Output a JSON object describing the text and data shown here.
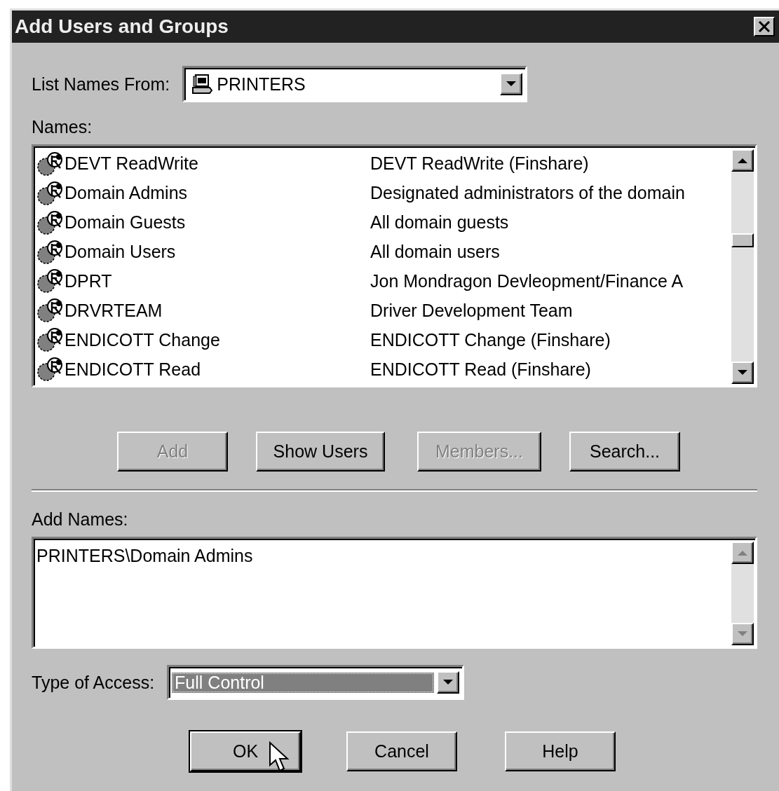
{
  "window": {
    "title": "Add Users and Groups"
  },
  "list_names_from": {
    "label": "List Names From:",
    "value": "PRINTERS"
  },
  "names": {
    "label": "Names:",
    "rows": [
      {
        "name": "DEVT ReadWrite",
        "description": "DEVT ReadWrite (Finshare)",
        "selected": false
      },
      {
        "name": "Domain Admins",
        "description": "Designated administrators of the domain",
        "selected": false
      },
      {
        "name": "Domain Guests",
        "description": "All domain guests",
        "selected": false
      },
      {
        "name": "Domain Users",
        "description": "All domain users",
        "selected": false
      },
      {
        "name": "DPRT",
        "description": "Jon Mondragon Devleopment/Finance A",
        "selected": false
      },
      {
        "name": "DRVRTEAM",
        "description": "Driver Development Team",
        "selected": false
      },
      {
        "name": "ENDICOTT Change",
        "description": "ENDICOTT Change (Finshare)",
        "selected": false
      },
      {
        "name": "ENDICOTT Read",
        "description": "ENDICOTT Read (Finshare)",
        "selected": false
      }
    ]
  },
  "action_buttons": [
    {
      "label": "Add",
      "disabled": true
    },
    {
      "label": "Show Users",
      "disabled": false
    },
    {
      "label": "Members...",
      "disabled": true
    },
    {
      "label": "Search...",
      "disabled": false
    }
  ],
  "add_names": {
    "label": "Add Names:",
    "value": "PRINTERS\\Domain Admins"
  },
  "type_of_access": {
    "label": "Type of Access:",
    "value": "Full Control"
  },
  "dialog_buttons": [
    {
      "label": "OK",
      "default": true
    },
    {
      "label": "Cancel",
      "default": false
    },
    {
      "label": "Help",
      "default": false
    }
  ]
}
